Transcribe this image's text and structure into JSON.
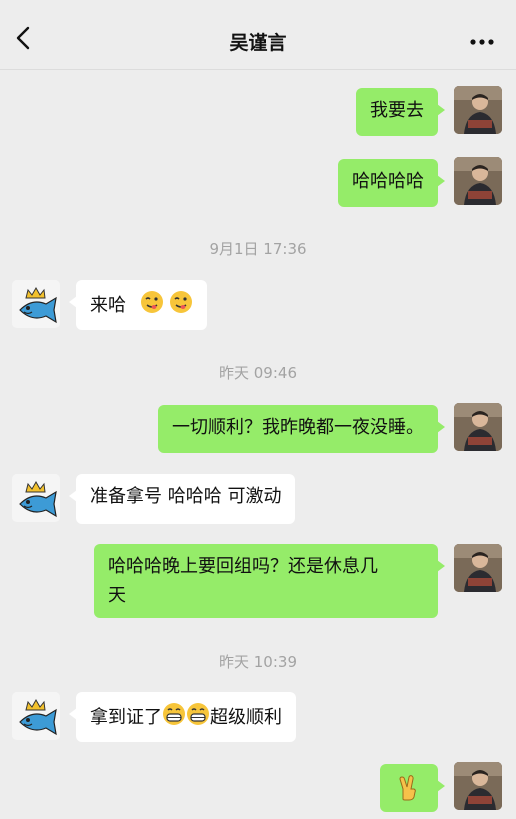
{
  "header": {
    "title": "吴谨言"
  },
  "messages": [
    {
      "text": "我要去"
    },
    {
      "text": "哈哈哈哈"
    },
    {
      "text": "来哈"
    },
    {
      "text": "一切顺利？我昨晚都一夜没睡。"
    },
    {
      "text": "准备拿号 哈哈哈 可激动"
    },
    {
      "line1": "哈哈哈晚上要回组吗？还是休息几",
      "line2": "天"
    },
    {
      "before": "拿到证了",
      "after": "超级顺利"
    }
  ],
  "timestamps": [
    "9月1日 17:36",
    "昨天 09:46",
    "昨天 10:39"
  ],
  "colors": {
    "me_bubble": "#95ec69",
    "them_bubble": "#ffffff",
    "background": "#ededed"
  },
  "icons": {
    "back": "chevron-left-icon",
    "more": "more-dots-icon",
    "emoji_wink": "wink-tongue-emoji",
    "emoji_grin": "grin-emoji",
    "emoji_victory": "victory-hand-emoji"
  }
}
